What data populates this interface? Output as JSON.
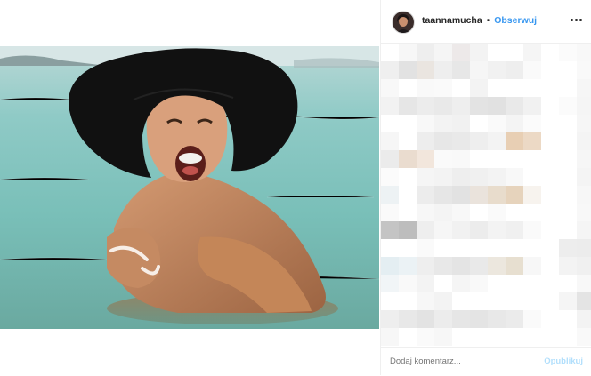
{
  "post": {
    "username": "taannamucha",
    "separator": "•",
    "follow_label": "Obserwuj",
    "more_icon": "more-options-icon"
  },
  "comment_box": {
    "placeholder": "Dodaj komentarz...",
    "publish_label": "Opublikuj"
  },
  "colors": {
    "follow": "#3897f0",
    "publish_disabled": "#b2dffc",
    "border": "#efefef"
  },
  "pixelated_comments": [
    [
      "#ffffff",
      "#f7f7f7",
      "#eeeeee",
      "#f5f5f5",
      "#ede9e9",
      "#f3f3f3",
      "#ffffff",
      "#ffffff",
      "#f5f5f5",
      "#ffffff",
      "#fbfbfb",
      "#f8f8f8"
    ],
    [
      "#efefef",
      "#e2e2e2",
      "#eae5e0",
      "#eeeeee",
      "#e7e7e7",
      "#f6f6f6",
      "#f1f1f1",
      "#eeeeee",
      "#fafafa",
      "#ffffff",
      "#ffffff",
      "#f9f9f9"
    ],
    [
      "#f8f8f8",
      "#ffffff",
      "#f9f9f9",
      "#fafafa",
      "#ffffff",
      "#f3f3f3",
      "#ffffff",
      "#ffffff",
      "#ffffff",
      "#ffffff",
      "#ffffff",
      "#f6f6f6"
    ],
    [
      "#f2f2f2",
      "#e6e6e6",
      "#ececec",
      "#e9e9e9",
      "#eeeeee",
      "#e3e3e3",
      "#e1e1e1",
      "#e9e9e9",
      "#f1f1f1",
      "#ffffff",
      "#fbfbfb",
      "#f5f5f5"
    ],
    [
      "#ffffff",
      "#ffffff",
      "#f8f8f8",
      "#f3f3f3",
      "#f1f1f1",
      "#ffffff",
      "#fafafa",
      "#f4f4f4",
      "#fbfbfb",
      "#ffffff",
      "#ffffff",
      "#f6f6f6"
    ],
    [
      "#f6f6f6",
      "#ffffff",
      "#ededed",
      "#e7e7e7",
      "#e9e9e9",
      "#eeeeee",
      "#f3f3f3",
      "#e8cfb4",
      "#ecd9c5",
      "#ffffff",
      "#ffffff",
      "#f4f4f4"
    ],
    [
      "#ebebeb",
      "#eadccf",
      "#f2e6dc",
      "#fafafa",
      "#f9f9f9",
      "#ffffff",
      "#ffffff",
      "#ffffff",
      "#ffffff",
      "#ffffff",
      "#ffffff",
      "#f6f6f6"
    ],
    [
      "#fbfbfb",
      "#ffffff",
      "#f5f5f5",
      "#f3f3f3",
      "#eeeeee",
      "#f0f0f0",
      "#f3f3f3",
      "#f8f8f8",
      "#ffffff",
      "#ffffff",
      "#ffffff",
      "#f4f4f4"
    ],
    [
      "#edf2f4",
      "#ffffff",
      "#ececec",
      "#e6e6e6",
      "#e2e2e2",
      "#eae3dc",
      "#e8dccc",
      "#e6d3bc",
      "#f7f3ee",
      "#ffffff",
      "#ffffff",
      "#f7f7f7"
    ],
    [
      "#fafafa",
      "#ffffff",
      "#f7f7f7",
      "#f4f4f4",
      "#f8f8f8",
      "#ffffff",
      "#fafafa",
      "#ffffff",
      "#ffffff",
      "#ffffff",
      "#ffffff",
      "#f8f8f8"
    ],
    [
      "#c4c4c4",
      "#bdbdbd",
      "#eeeeee",
      "#f6f6f6",
      "#f1f1f1",
      "#ececec",
      "#f3f3f3",
      "#f0f0f0",
      "#fafafa",
      "#ffffff",
      "#ffffff",
      "#f5f5f5"
    ],
    [
      "#ffffff",
      "#ffffff",
      "#fafafa",
      "#ffffff",
      "#ffffff",
      "#ffffff",
      "#ffffff",
      "#ffffff",
      "#ffffff",
      "#ffffff",
      "#ededed",
      "#ececec"
    ],
    [
      "#e4eef2",
      "#ebf2f5",
      "#eeeeee",
      "#e8e8e8",
      "#e4e4e4",
      "#e9e9e9",
      "#ece7de",
      "#e7dfd0",
      "#f7f7f7",
      "#ffffff",
      "#f3f3f3",
      "#f0f0f0"
    ],
    [
      "#f1f5f7",
      "#f9f9f9",
      "#f3f3f3",
      "#ffffff",
      "#f5f5f5",
      "#f9f9f9",
      "#ffffff",
      "#ffffff",
      "#ffffff",
      "#ffffff",
      "#ffffff",
      "#f8f8f8"
    ],
    [
      "#ffffff",
      "#ffffff",
      "#f7f7f7",
      "#f3f3f3",
      "#ffffff",
      "#ffffff",
      "#ffffff",
      "#ffffff",
      "#ffffff",
      "#ffffff",
      "#f5f5f5",
      "#e4e4e4"
    ],
    [
      "#eeeeee",
      "#e8e8e8",
      "#e3e3e3",
      "#ececec",
      "#e6e6e6",
      "#e4e4e4",
      "#e8e8e8",
      "#ebebeb",
      "#fafafa",
      "#ffffff",
      "#ffffff",
      "#f3f3f3"
    ],
    [
      "#f7f7f7",
      "#ffffff",
      "#fafafa",
      "#f7f7f7",
      "#ffffff",
      "#ffffff",
      "#ffffff",
      "#ffffff",
      "#ffffff",
      "#ffffff",
      "#ffffff",
      "#f9f9f9"
    ]
  ]
}
